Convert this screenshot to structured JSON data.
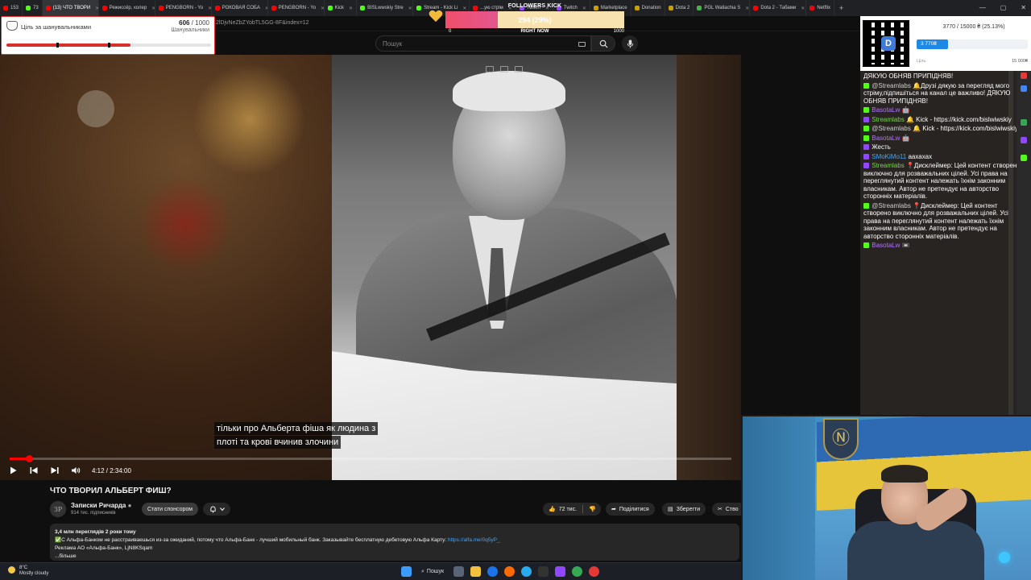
{
  "tabs": [
    {
      "label": "153",
      "icon": "youtube"
    },
    {
      "label": "73",
      "icon": "kick"
    },
    {
      "label": "(13) ЧТО ТВОРИ",
      "icon": "youtube"
    },
    {
      "label": "Режиссёр, колер",
      "icon": "youtube"
    },
    {
      "label": "PENGBORN - Yo",
      "icon": "youtube"
    },
    {
      "label": "РОКОВАЯ СОБА",
      "icon": "youtube"
    },
    {
      "label": "PENGBORN - Yo",
      "icon": "youtube"
    },
    {
      "label": "Kick",
      "icon": "kick"
    },
    {
      "label": "BISLwwskiy Stre",
      "icon": "kick"
    },
    {
      "label": "Stream - Kick Li",
      "icon": "kick"
    },
    {
      "label": "...ую стрім",
      "icon": "youtube"
    },
    {
      "label": "Twitch",
      "icon": "twitch"
    },
    {
      "label": "Twitch",
      "icon": "twitch"
    },
    {
      "label": "Marketplace",
      "icon": "ext"
    },
    {
      "label": "Donation",
      "icon": "ext"
    },
    {
      "label": "Dota 2",
      "icon": "ext"
    },
    {
      "label": "PGL Wallachia S",
      "icon": "green"
    },
    {
      "label": "Dota 2 - Табами",
      "icon": "youtube"
    },
    {
      "label": "Netflix",
      "icon": "netflix"
    }
  ],
  "address": {
    "url": "2lDjvNeZbZYobTL5GG-8F&index=12"
  },
  "search": {
    "placeholder": "Пошук"
  },
  "video": {
    "subtitle_line1": "тільки про Альберта фіша як людина з",
    "subtitle_line2": "плоті та крові вчинив злочини",
    "time": "4:12 / 2:34:00",
    "progress": 0.027,
    "title": "ЧТО ТВОРИЛ АЛЬБЕРТ ФИШ?"
  },
  "channel": {
    "avatar_text": "ЗР",
    "name": "Записки Ричарда",
    "subs": "914 тис. підписників",
    "sponsor_label": "Стати спонсором"
  },
  "actions": {
    "likes": "72 тис.",
    "share": "Поділитися",
    "save": "Зберегти",
    "clip": "Ство"
  },
  "description": {
    "meta": "3,4 млн переглядів  2 роки тому",
    "line1": "С Альфа-Банком не расстраиваешься из-за ожиданий, потому что Альфа-Банк - лучший мобильный банк. Заказывайте бесплатную дебетовую Альфа Карту: ",
    "link": "https://alfa.me/0q5yP_",
    "line2": "Реклама АО «Альфа-Банк», LjN8KSqam",
    "more": "...більше"
  },
  "taskbar": {
    "temp": "8°C",
    "weather": "Mostly cloudy",
    "search_label": "Пошук"
  },
  "goal_widget": {
    "label": "Ціль за шанувальниками",
    "current": "606",
    "total": "/ 1000",
    "sub": "Шанувальники",
    "progress": 0.606
  },
  "followers_widget": {
    "title": "FOLLOWERS KICK",
    "value": "294 (29%)",
    "min": "0",
    "now": "RIGHT NOW",
    "max": "1000",
    "progress": 0.294
  },
  "donation_widget": {
    "total": "3770 / 15000 ₴ (25.13%)",
    "current": "3 770₴",
    "min": "Ціль",
    "max": "15 000₴",
    "progress": 0.2513
  },
  "chat": [
    {
      "badge": "",
      "user": "",
      "text": "ДЯКУЮ ОБНЯВ ПРИПІДНЯВ!",
      "color": "#ffffff"
    },
    {
      "badge": "kick",
      "user": "@Streamlabs",
      "text": "🔔Друзі дякую за перегляд мого стріму,підпишіться на канал це важливо! ДЯКУЮ ОБНЯВ ПРИПІДНЯВ!",
      "color": "#cfcfcf"
    },
    {
      "badge": "kick",
      "user": "BasotaLw",
      "text": "🤖",
      "color": "#b574ff"
    },
    {
      "badge": "tw",
      "user": "Streamlabs",
      "text": "🔔 Kick - https://kick.com/bislwiwskiy",
      "color": "#79d44c"
    },
    {
      "badge": "kick",
      "user": "@Streamlabs",
      "text": "🔔 Kick - https://kick.com/bislwiwskiy",
      "color": "#cfcfcf"
    },
    {
      "badge": "kick",
      "user": "BasotaLw",
      "text": "🤖",
      "color": "#b574ff"
    },
    {
      "badge": "tw",
      "user": "",
      "text": "Жесть",
      "color": "#b574ff"
    },
    {
      "badge": "tw",
      "user": "SMoKiMo11",
      "text": "аахахах",
      "color": "#3fa9ff"
    },
    {
      "badge": "tw",
      "user": "Streamlabs",
      "text": "📍Дисклеймер: Цей контент створено виключно для розважальних цілей. Усі права на переглянутий контент належать їхнім законним власникам. Автор не претендує на авторство сторонніх матеріалів.",
      "color": "#79d44c"
    },
    {
      "badge": "kick",
      "user": "@Streamlabs",
      "text": "📍Дисклеймер: Цей контент створено виключно для розважальних цілей. Усі права на переглянутий контент належать їхнім законним власникам. Автор не претендує на авторство сторонніх матеріалів.",
      "color": "#cfcfcf"
    },
    {
      "badge": "kick",
      "user": "BasotaLw",
      "text": "📼",
      "color": "#b574ff"
    }
  ],
  "webcam": {
    "emblem": "Ⓝ"
  },
  "colors": {
    "accent": "#ff0000",
    "kick": "#53fc18",
    "twitch": "#9146ff",
    "goal": "#d9302c",
    "donation": "#1e88e5"
  }
}
